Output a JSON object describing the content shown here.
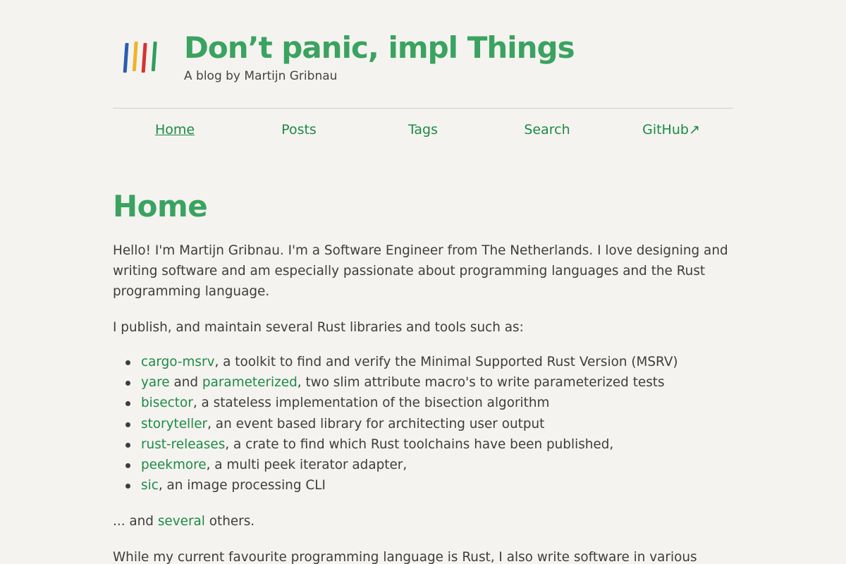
{
  "header": {
    "title": "Don’t panic, impl Things",
    "subtitle": "A blog by Martijn Gribnau",
    "logo_colors": [
      "#2a5db0",
      "#f0b429",
      "#d63232",
      "#2e9e5b"
    ]
  },
  "nav": [
    {
      "label": "Home"
    },
    {
      "label": "Posts"
    },
    {
      "label": "Tags"
    },
    {
      "label": "Search"
    },
    {
      "label": "GitHub↗"
    }
  ],
  "main": {
    "title": "Home",
    "intro": "Hello! I'm Martijn Gribnau. I'm a Software Engineer from The Netherlands. I love designing and writing software and am especially passionate about programming languages and the Rust programming language.",
    "publish_text": "I publish, and maintain several Rust libraries and tools such as:",
    "projects": [
      {
        "link": "cargo-msrv",
        "desc": ", a toolkit to find and verify the Minimal Supported Rust Version (MSRV)"
      },
      {
        "link": "yare",
        "mid": " and ",
        "link2": "parameterized",
        "desc": ", two slim attribute macro's to write parameterized tests"
      },
      {
        "link": "bisector",
        "desc": ", a stateless implementation of the bisection algorithm"
      },
      {
        "link": "storyteller",
        "desc": ", an event based library for architecting user output"
      },
      {
        "link": "rust-releases",
        "desc": ", a crate to find which Rust toolchains have been published,"
      },
      {
        "link": "peekmore",
        "desc": ", a multi peek iterator adapter,"
      },
      {
        "link": "sic",
        "desc": ", an image processing CLI"
      }
    ],
    "others_prefix": "... and ",
    "others_link": "several",
    "others_suffix": " others.",
    "closing": "While my current favourite programming language is Rust, I also write software in various"
  },
  "colors": {
    "accent": "#3aa35f",
    "link": "#1d8a44",
    "background": "#f4f3f0",
    "text": "#3d3d3d"
  }
}
